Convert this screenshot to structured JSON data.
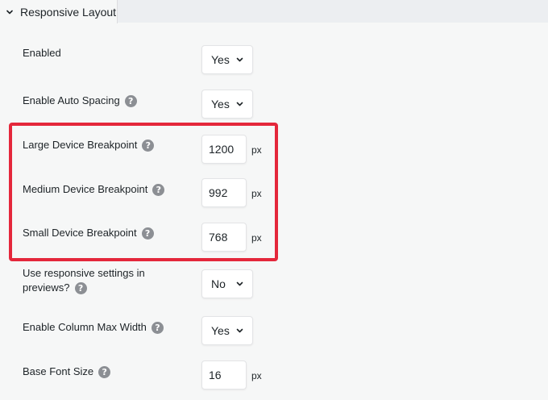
{
  "section": {
    "title": "Responsive Layout"
  },
  "settings": {
    "enabled": {
      "label": "Enabled",
      "value": "Yes"
    },
    "auto_spacing": {
      "label": "Enable Auto Spacing",
      "value": "Yes"
    },
    "large_breakpoint": {
      "label": "Large Device Breakpoint",
      "value": "1200",
      "unit": "px"
    },
    "medium_breakpoint": {
      "label": "Medium Device Breakpoint",
      "value": "992",
      "unit": "px"
    },
    "small_breakpoint": {
      "label": "Small Device Breakpoint",
      "value": "768",
      "unit": "px"
    },
    "responsive_previews": {
      "label_line1": "Use responsive settings in",
      "label_line2": "previews?",
      "value": "No"
    },
    "column_max_width": {
      "label": "Enable Column Max Width",
      "value": "Yes"
    },
    "base_font_size": {
      "label": "Base Font Size",
      "value": "16",
      "unit": "px"
    }
  },
  "icons": {
    "help": "question-mark-icon",
    "toggle": "chevron-down-icon",
    "select_caret": "chevron-down-icon"
  },
  "colors": {
    "highlight_border": "#e4273b",
    "help_icon": "#8c8f94",
    "background": "#f6f7f7"
  }
}
